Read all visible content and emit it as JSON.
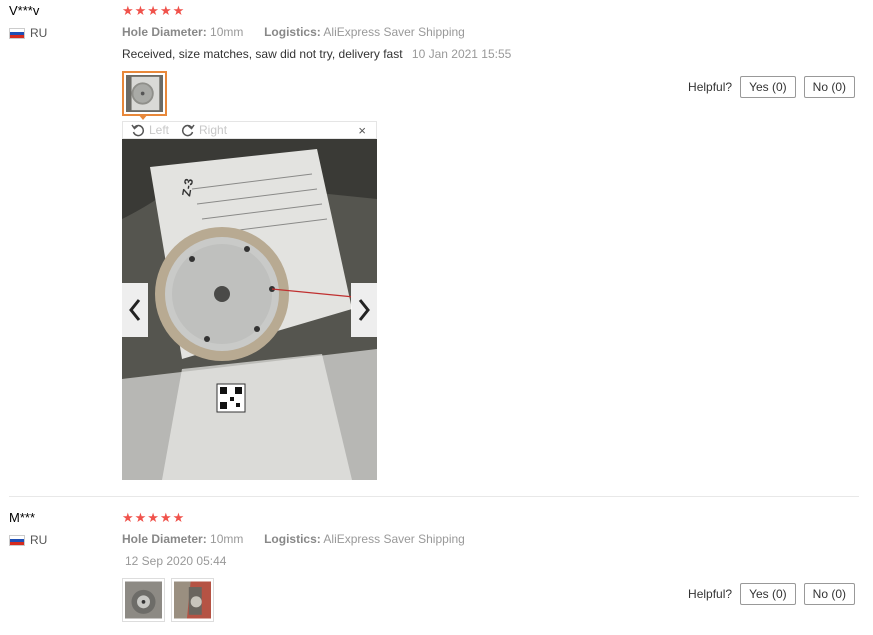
{
  "reviews": [
    {
      "user": "V***v",
      "country": "RU",
      "stars": "★★★★★",
      "hole_label": "Hole Diameter:",
      "hole_value": "10mm",
      "logistics_label": "Logistics:",
      "logistics_value": "AliExpress Saver Shipping",
      "comment": "Received, size matches, saw did not try, delivery fast",
      "date": "10 Jan 2021 15:55",
      "helpful_label": "Helpful?",
      "yes_label": "Yes (0)",
      "no_label": "No (0)",
      "viewer": {
        "rotate_left": "Left",
        "rotate_right": "Right",
        "close": "×"
      }
    },
    {
      "user": "M***",
      "country": "RU",
      "stars": "★★★★★",
      "hole_label": "Hole Diameter:",
      "hole_value": "10mm",
      "logistics_label": "Logistics:",
      "logistics_value": "AliExpress Saver Shipping",
      "date": "12 Sep 2020 05:44",
      "helpful_label": "Helpful?",
      "yes_label": "Yes (0)",
      "no_label": "No (0)"
    }
  ],
  "colors": {
    "star": "#f0524b",
    "active_thumb_border": "#e8883a"
  }
}
